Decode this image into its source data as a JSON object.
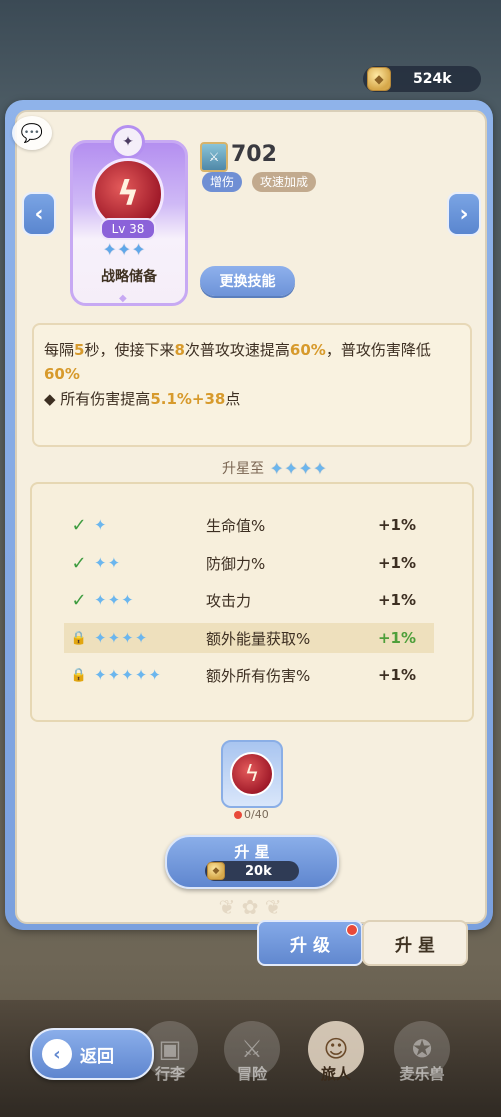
{
  "currency": {
    "value": "524k"
  },
  "skill": {
    "level": "Lv 38",
    "name": "战略储备",
    "power": "702",
    "tags": [
      "增伤",
      "攻速加成"
    ],
    "change_button": "更换技能"
  },
  "description": {
    "line1_parts": [
      "每隔",
      "5",
      "秒，使接下来",
      "8",
      "次普攻攻速提高",
      "60%",
      "，普攻伤害降低",
      "60%"
    ],
    "line2_parts": [
      "◆ 所有伤害提高",
      "5.1%",
      "+",
      "38",
      "点"
    ]
  },
  "starup_heading": "升星至",
  "bonus_rows": [
    {
      "stars": 1,
      "name": "生命值%",
      "value": "+1%",
      "status": "done"
    },
    {
      "stars": 2,
      "name": "防御力%",
      "value": "+1%",
      "status": "done"
    },
    {
      "stars": 3,
      "name": "攻击力",
      "value": "+1%",
      "status": "done"
    },
    {
      "stars": 4,
      "name": "额外能量获取%",
      "value": "+1%",
      "status": "next"
    },
    {
      "stars": 5,
      "name": "额外所有伤害%",
      "value": "+1%",
      "status": "locked"
    }
  ],
  "material": {
    "count": "0/40"
  },
  "starup_button": {
    "label": "升 星",
    "cost": "20k"
  },
  "tabs": {
    "upgrade": "升 级",
    "star": "升 星"
  },
  "bottom_nav": [
    "行李",
    "冒险",
    "旅人",
    "麦乐兽"
  ],
  "back_button": "返回",
  "colors": {
    "accent_blue": "#6f8fd4",
    "highlight": "#d79a2c",
    "green": "#4e9f3a"
  }
}
